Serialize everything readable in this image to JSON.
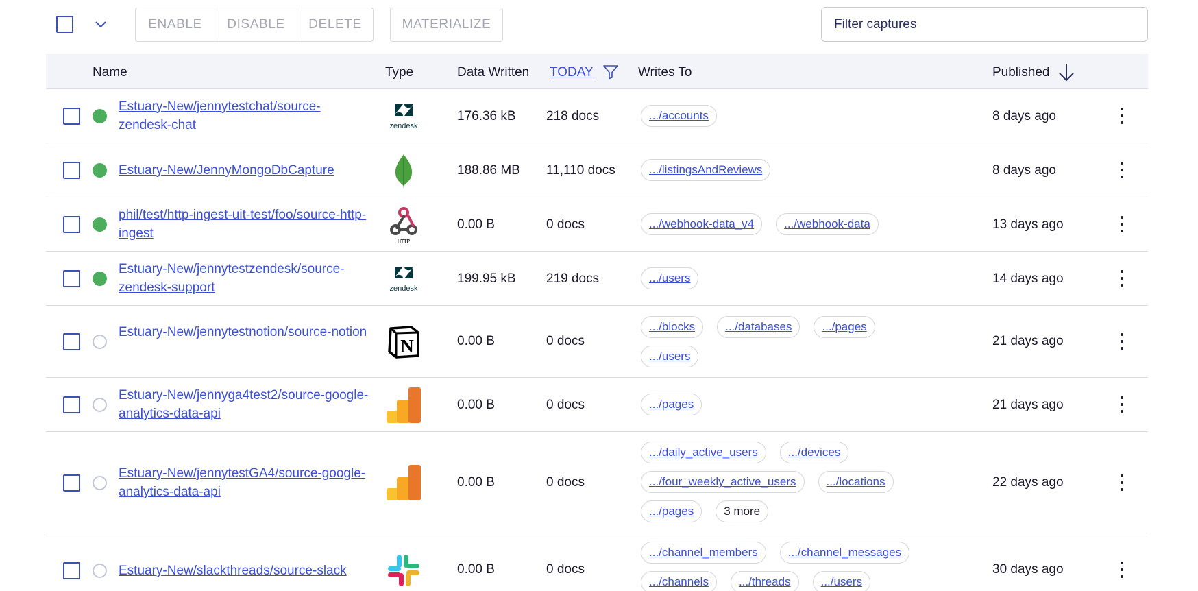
{
  "toolbar": {
    "enable_label": "ENABLE",
    "disable_label": "DISABLE",
    "delete_label": "DELETE",
    "materialize_label": "MATERIALIZE",
    "filter_placeholder": "Filter captures"
  },
  "table": {
    "headers": {
      "name": "Name",
      "type": "Type",
      "data_written": "Data Written",
      "period": "TODAY",
      "writes_to": "Writes To",
      "published": "Published"
    },
    "rows": [
      {
        "name": "Estuary-New/jennytestchat/source-zendesk-chat",
        "status": "active",
        "type_icon": "zendesk-logo-icon",
        "data_written": "176.36 kB",
        "docs": "218 docs",
        "writes_to": [
          ".../accounts"
        ],
        "published": "8 days ago"
      },
      {
        "name": "Estuary-New/JennyMongoDbCapture",
        "status": "active",
        "type_icon": "mongodb-logo-icon",
        "data_written": "188.86 MB",
        "docs": "11,110 docs",
        "writes_to": [
          ".../listingsAndReviews"
        ],
        "published": "8 days ago"
      },
      {
        "name": "phil/test/http-ingest-uit-test/foo/source-http-ingest",
        "status": "active",
        "type_icon": "http-webhook-logo-icon",
        "data_written": "0.00 B",
        "docs": "0 docs",
        "writes_to": [
          ".../webhook-data_v4",
          ".../webhook-data"
        ],
        "published": "13 days ago"
      },
      {
        "name": "Estuary-New/jennytestzendesk/source-zendesk-support",
        "status": "active",
        "type_icon": "zendesk-logo-icon",
        "data_written": "199.95 kB",
        "docs": "219 docs",
        "writes_to": [
          ".../users"
        ],
        "published": "14 days ago"
      },
      {
        "name": "Estuary-New/jennytestnotion/source-notion",
        "status": "inactive",
        "type_icon": "notion-logo-icon",
        "data_written": "0.00 B",
        "docs": "0 docs",
        "writes_to": [
          ".../blocks",
          ".../databases",
          ".../pages",
          ".../users"
        ],
        "published": "21 days ago"
      },
      {
        "name": "Estuary-New/jennyga4test2/source-google-analytics-data-api",
        "status": "inactive",
        "type_icon": "google-analytics-logo-icon",
        "data_written": "0.00 B",
        "docs": "0 docs",
        "writes_to": [
          ".../pages"
        ],
        "published": "21 days ago"
      },
      {
        "name": "Estuary-New/jennytestGA4/source-google-analytics-data-api",
        "status": "inactive",
        "type_icon": "google-analytics-logo-icon",
        "data_written": "0.00 B",
        "docs": "0 docs",
        "writes_to": [
          ".../daily_active_users",
          ".../devices",
          ".../four_weekly_active_users",
          ".../locations",
          ".../pages"
        ],
        "writes_to_more": "3 more",
        "published": "22 days ago"
      },
      {
        "name": "Estuary-New/slackthreads/source-slack",
        "status": "inactive",
        "type_icon": "slack-logo-icon",
        "data_written": "0.00 B",
        "docs": "0 docs",
        "writes_to": [
          ".../channel_members",
          ".../channel_messages",
          ".../channels",
          ".../threads",
          ".../users"
        ],
        "published": "30 days ago"
      }
    ]
  },
  "colors": {
    "link": "#3b4fd8",
    "active_status": "#4cae5c",
    "header_bg": "#f3f4f9",
    "disabled_text": "#a4a7b3"
  }
}
